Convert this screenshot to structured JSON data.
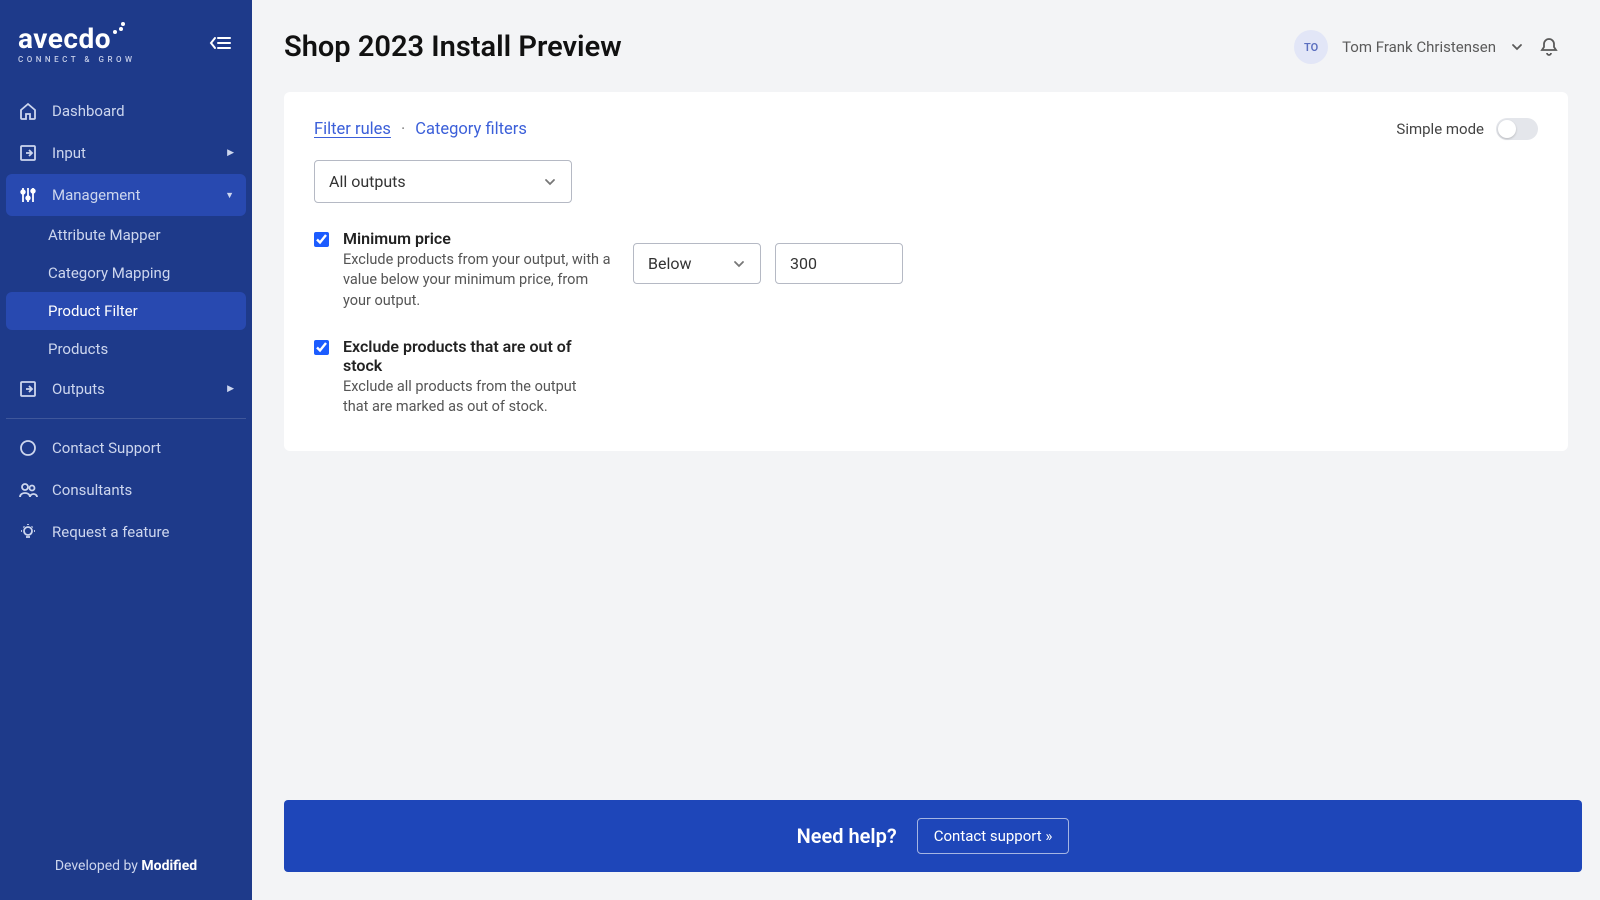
{
  "brand": {
    "name": "avecdo",
    "tagline": "CONNECT & GROW"
  },
  "sidebar": {
    "dashboard": "Dashboard",
    "input": "Input",
    "management": "Management",
    "sub": {
      "attribute_mapper": "Attribute Mapper",
      "category_mapping": "Category Mapping",
      "product_filter": "Product Filter",
      "products": "Products"
    },
    "outputs": "Outputs",
    "contact_support": "Contact Support",
    "consultants": "Consultants",
    "request_feature": "Request a feature",
    "footer_prefix": "Developed by ",
    "footer_brand": "Modified"
  },
  "header": {
    "title": "Shop 2023 Install Preview",
    "user_initials": "TO",
    "user_name": "Tom Frank Christensen"
  },
  "panel": {
    "tab_filter_rules": "Filter rules",
    "tab_category_filters": "Category filters",
    "simple_mode_label": "Simple mode",
    "outputs_selected": "All outputs",
    "rule1": {
      "title": "Minimum price",
      "desc": "Exclude products from your output, with a value below your minimum price, from your output.",
      "operator": "Below",
      "value": "300"
    },
    "rule2": {
      "title": "Exclude products that are out of stock",
      "desc": "Exclude all products from the output that are marked as out of stock."
    }
  },
  "help": {
    "text": "Need help?",
    "button": "Contact support »"
  }
}
